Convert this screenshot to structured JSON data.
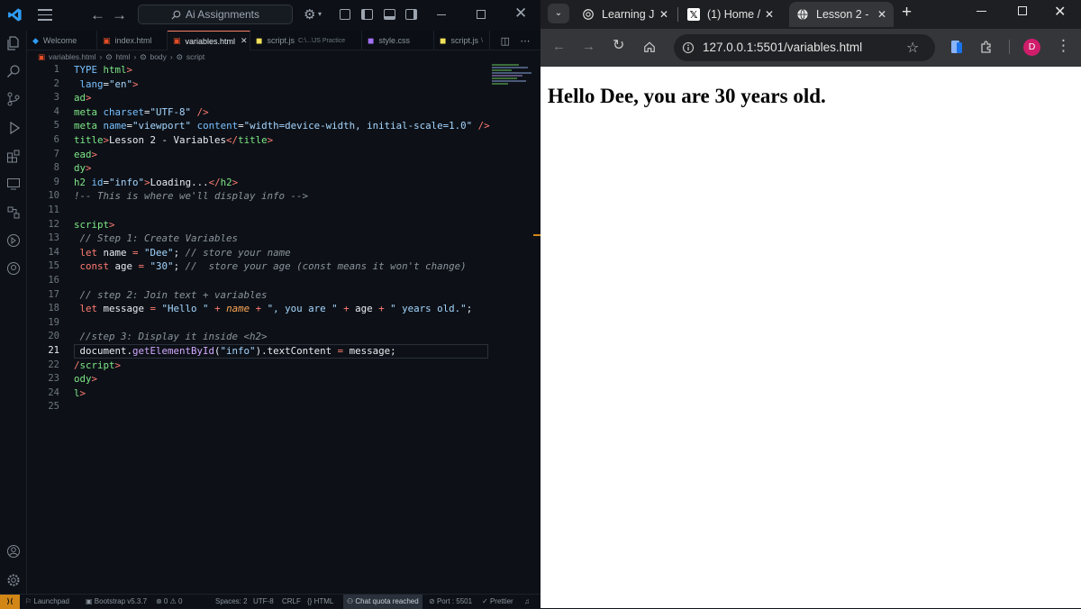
{
  "vscode": {
    "search_label": "Ai Assignments",
    "tabs": [
      {
        "icon": "vscode-icon",
        "label": "Welcome"
      },
      {
        "icon": "html5-icon",
        "label": "index.html"
      },
      {
        "icon": "html5-icon",
        "label": "variables.html"
      },
      {
        "icon": "js-icon",
        "label": "script.js",
        "path": "C:\\...\\JS Practice"
      },
      {
        "icon": "css-icon",
        "label": "style.css"
      },
      {
        "icon": "js-icon",
        "label": "script.js",
        "path": "\\"
      }
    ],
    "breadcrumb": [
      "variables.html",
      "html",
      "body",
      "script"
    ],
    "line_numbers": [
      "1",
      "2",
      "3",
      "4",
      "5",
      "6",
      "7",
      "8",
      "9",
      "10",
      "11",
      "12",
      "13",
      "14",
      "15",
      "16",
      "17",
      "18",
      "19",
      "20",
      "21",
      "22",
      "23",
      "24",
      "25"
    ],
    "current_line": "21",
    "status": {
      "launchpad": "Launchpad",
      "bootstrap": "Bootstrap v5.3.7",
      "problems": "⊗ 0 ⚠ 0",
      "spaces": "Spaces: 2",
      "encoding": "UTF-8",
      "eol": "CRLF",
      "language": "HTML",
      "chat": "Chat quota reached",
      "port": "Port : 5501",
      "prettier": "Prettier"
    }
  },
  "code_lines": [
    [
      [
        "TYPE ",
        "a"
      ],
      [
        "html",
        "t"
      ],
      [
        ">",
        "k"
      ]
    ],
    [
      [
        " lang",
        "a"
      ],
      [
        "=",
        "p"
      ],
      [
        "\"en\"",
        "s"
      ],
      [
        ">",
        "k"
      ]
    ],
    [
      [
        "ad",
        "t"
      ],
      [
        ">",
        "k"
      ]
    ],
    [
      [
        "meta ",
        "t"
      ],
      [
        "charset",
        "a"
      ],
      [
        "=",
        "p"
      ],
      [
        "\"UTF-8\"",
        "s"
      ],
      [
        " />",
        "k"
      ]
    ],
    [
      [
        "meta ",
        "t"
      ],
      [
        "name",
        "a"
      ],
      [
        "=",
        "p"
      ],
      [
        "\"viewport\" ",
        "s"
      ],
      [
        "content",
        "a"
      ],
      [
        "=",
        "p"
      ],
      [
        "\"width=device-width, initial-scale=1.0\"",
        "s"
      ],
      [
        " />",
        "k"
      ]
    ],
    [
      [
        "title",
        "t"
      ],
      [
        ">",
        "k"
      ],
      [
        "Lesson 2 - Variables",
        "p"
      ],
      [
        "</",
        "k"
      ],
      [
        "title",
        "t"
      ],
      [
        ">",
        "k"
      ]
    ],
    [
      [
        "ead",
        "t"
      ],
      [
        ">",
        "k"
      ]
    ],
    [
      [
        "dy",
        "t"
      ],
      [
        ">",
        "k"
      ]
    ],
    [
      [
        "h2 ",
        "t"
      ],
      [
        "id",
        "a"
      ],
      [
        "=",
        "p"
      ],
      [
        "\"info\"",
        "s"
      ],
      [
        ">",
        "k"
      ],
      [
        "Loading...",
        "p"
      ],
      [
        "</",
        "k"
      ],
      [
        "h2",
        "t"
      ],
      [
        ">",
        "k"
      ]
    ],
    [
      [
        "!-- This is where we'll display info -->",
        "c"
      ]
    ],
    [],
    [
      [
        "script",
        "t"
      ],
      [
        ">",
        "k"
      ]
    ],
    [
      [
        " // Step 1: Create Variables",
        "c"
      ]
    ],
    [
      [
        " let ",
        "k"
      ],
      [
        "name ",
        "p"
      ],
      [
        "= ",
        "k"
      ],
      [
        "\"Dee\"",
        "s"
      ],
      [
        "; ",
        "p"
      ],
      [
        "// store your name",
        "c"
      ]
    ],
    [
      [
        " const ",
        "k"
      ],
      [
        "age ",
        "p"
      ],
      [
        "= ",
        "k"
      ],
      [
        "\"30\"",
        "s"
      ],
      [
        "; ",
        "p"
      ],
      [
        "//  store your age (const means it won't change)",
        "c"
      ]
    ],
    [],
    [
      [
        " // step 2: Join text + variables",
        "c"
      ]
    ],
    [
      [
        " let ",
        "k"
      ],
      [
        "message ",
        "p"
      ],
      [
        "= ",
        "k"
      ],
      [
        "\"Hello \" ",
        "s"
      ],
      [
        "+ ",
        "k"
      ],
      [
        "name",
        "v"
      ],
      [
        " + ",
        "k"
      ],
      [
        "\", you are \" ",
        "s"
      ],
      [
        "+ ",
        "k"
      ],
      [
        "age ",
        "p"
      ],
      [
        "+ ",
        "k"
      ],
      [
        "\" years old.\"",
        "s"
      ],
      [
        ";",
        "p"
      ]
    ],
    [],
    [
      [
        " //step 3: Display it inside <h2>",
        "c"
      ]
    ],
    [
      [
        " document.",
        "p"
      ],
      [
        "getElementById",
        "f"
      ],
      [
        "(",
        "p"
      ],
      [
        "\"info\"",
        "s"
      ],
      [
        ").textContent ",
        "p"
      ],
      [
        "= ",
        "k"
      ],
      [
        "message;",
        "p"
      ]
    ],
    [
      [
        "/",
        "k"
      ],
      [
        "script",
        "t"
      ],
      [
        ">",
        "k"
      ]
    ],
    [
      [
        "ody",
        "t"
      ],
      [
        ">",
        "k"
      ]
    ],
    [
      [
        "l",
        "t"
      ],
      [
        ">",
        "k"
      ]
    ],
    []
  ],
  "chrome": {
    "tabs": [
      "Learning J",
      "(1) Home /",
      "Lesson 2 -"
    ],
    "url": "127.0.0.1:5501/variables.html",
    "profile_initial": "D",
    "page_heading": "Hello Dee, you are 30 years old."
  },
  "colors": {
    "editor_bg": "#0d1117",
    "accent": "#f78166",
    "chrome_frame": "#35363a",
    "profile": "#d01d6b"
  }
}
